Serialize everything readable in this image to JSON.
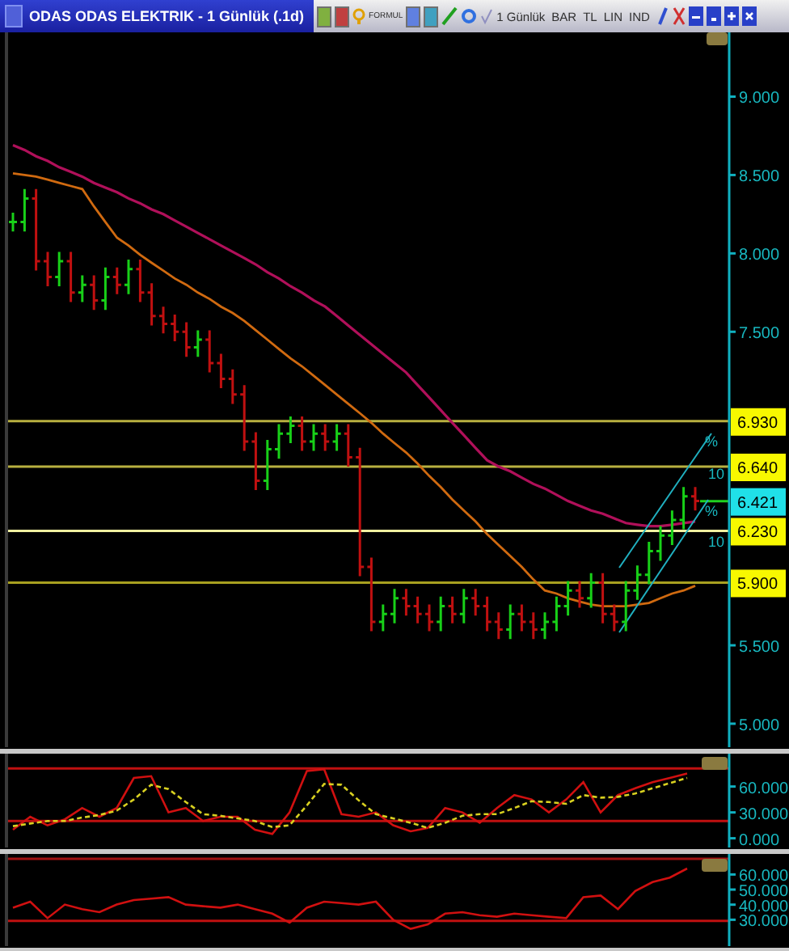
{
  "window": {
    "title": "ODAS ODAS ELEKTRIK - 1 Günlük (.1d)",
    "toolbar": [
      "FORMUL",
      "1 Günlük",
      "BAR",
      "TL",
      "LIN",
      "IND"
    ]
  },
  "price_panel": {
    "chart_data": {
      "type": "line",
      "ylim": [
        4.85,
        9.41
      ],
      "yticks": [
        {
          "value": 9,
          "label": "9.000"
        },
        {
          "value": 8.5,
          "label": "8.500"
        },
        {
          "value": 8,
          "label": "8.000"
        },
        {
          "value": 7.5,
          "label": "7.500"
        },
        {
          "value": 5.5,
          "label": "5.500"
        },
        {
          "value": 5,
          "label": "5.000"
        }
      ],
      "series": [
        {
          "color": "#b0105a",
          "values": [
            8.69,
            8.66,
            8.62,
            8.59,
            8.55,
            8.52,
            8.49,
            8.45,
            8.42,
            8.39,
            8.35,
            8.32,
            8.28,
            8.25,
            8.21,
            8.17,
            8.13,
            8.09,
            8.05,
            8.01,
            7.97,
            7.93,
            7.88,
            7.84,
            7.79,
            7.75,
            7.7,
            7.66,
            7.6,
            7.54,
            7.48,
            7.42,
            7.36,
            7.3,
            7.24,
            7.16,
            7.08,
            7.0,
            6.92,
            6.84,
            6.76,
            6.68,
            6.64,
            6.61,
            6.57,
            6.53,
            6.5,
            6.46,
            6.42,
            6.39,
            6.36,
            6.34,
            6.31,
            6.28,
            6.27,
            6.26,
            6.26,
            6.27,
            6.28,
            6.29
          ]
        },
        {
          "color": "#d06a10",
          "values": [
            8.51,
            8.5,
            8.49,
            8.47,
            8.45,
            8.43,
            8.41,
            8.3,
            8.2,
            8.1,
            8.05,
            7.99,
            7.94,
            7.89,
            7.84,
            7.8,
            7.75,
            7.71,
            7.66,
            7.62,
            7.57,
            7.51,
            7.45,
            7.39,
            7.33,
            7.28,
            7.22,
            7.16,
            7.1,
            7.04,
            6.98,
            6.92,
            6.85,
            6.79,
            6.73,
            6.66,
            6.58,
            6.51,
            6.43,
            6.36,
            6.29,
            6.21,
            6.14,
            6.07,
            6.0,
            5.92,
            5.85,
            5.83,
            5.8,
            5.78,
            5.76,
            5.75,
            5.75,
            5.75,
            5.76,
            5.77,
            5.8,
            5.83,
            5.85,
            5.88
          ]
        }
      ],
      "ref_lines": [
        {
          "axis": "y",
          "value": 6.93,
          "label": "6.930",
          "color": "#b8b040"
        },
        {
          "axis": "y",
          "value": 6.64,
          "label": "6.640",
          "color": "#b8b040"
        },
        {
          "axis": "y",
          "value": 6.23,
          "label": "6.230",
          "color": "#f0f0a0"
        },
        {
          "axis": "y",
          "value": 5.9,
          "label": "5.900",
          "color": "#a8a020"
        }
      ],
      "annotations": [
        "6.421"
      ]
    },
    "channel_labels": [
      "%",
      "10",
      "%",
      "10"
    ]
  },
  "oscillator_panel": {
    "chart_data": {
      "type": "line",
      "ylim": [
        -10.7,
        98.1
      ],
      "yticks": [
        {
          "value": 60,
          "label": "60.000"
        },
        {
          "value": 30,
          "label": "30.000"
        },
        {
          "value": 0,
          "label": "0.000"
        }
      ],
      "series": [
        {
          "color": "#d01010",
          "values": [
            10,
            25,
            15,
            22,
            35,
            25,
            35,
            70,
            72,
            30,
            35,
            20,
            25,
            25,
            10,
            5,
            30,
            78,
            80,
            28,
            25,
            30,
            15,
            8,
            12,
            35,
            30,
            18,
            35,
            50,
            45,
            30,
            45,
            65,
            30,
            50,
            58,
            65,
            70,
            75
          ]
        },
        {
          "color": "#d8d020",
          "line_style": "dashed",
          "values": [
            14,
            17,
            20,
            20,
            24,
            27,
            32,
            45,
            62,
            57,
            42,
            28,
            26,
            23,
            20,
            13,
            15,
            38,
            63,
            62,
            44,
            28,
            23,
            18,
            12,
            18,
            26,
            28,
            28,
            35,
            43,
            42,
            40,
            50,
            47,
            48,
            52,
            58,
            64,
            70
          ]
        }
      ],
      "ref_lines": [
        {
          "axis": "y",
          "value": 81,
          "color": "#c01010"
        },
        {
          "axis": "y",
          "value": 20,
          "color": "#c01010"
        }
      ]
    }
  },
  "indicator_panel": {
    "chart_data": {
      "type": "line",
      "ylim": [
        12.5,
        73.6
      ],
      "yticks": [
        {
          "value": 60,
          "label": "60.000"
        },
        {
          "value": 50,
          "label": "50.000"
        },
        {
          "value": 40,
          "label": "40.000"
        },
        {
          "value": 30,
          "label": "30.000"
        }
      ],
      "series": [
        {
          "color": "#d01010",
          "values": [
            38,
            42,
            31,
            40,
            37,
            35,
            40,
            43,
            44,
            45,
            40,
            39,
            38,
            40,
            37,
            34,
            28,
            38,
            42,
            41,
            40,
            42,
            30,
            24,
            27,
            34,
            35,
            33,
            32,
            34,
            33,
            32,
            31,
            45,
            46,
            37,
            49,
            55,
            58,
            64
          ]
        }
      ],
      "ref_lines": [
        {
          "axis": "y",
          "value": 70.4,
          "color": "#a01010"
        },
        {
          "axis": "y",
          "value": 29.3,
          "color": "#c01010"
        }
      ]
    }
  }
}
